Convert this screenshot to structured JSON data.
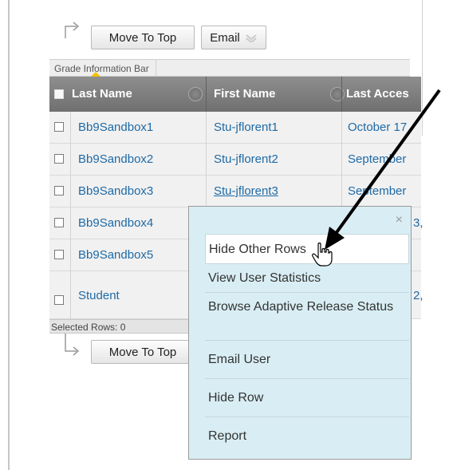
{
  "toolbar_top": {
    "move_to_top": "Move To Top",
    "email": "Email"
  },
  "grade_info_bar": "Grade Information Bar",
  "table": {
    "columns": [
      "Last Name",
      "First Name",
      "Last Acces"
    ],
    "rows": [
      {
        "last": "Bb9Sandbox1",
        "first": "Stu-jflorent1",
        "access": "October 17"
      },
      {
        "last": "Bb9Sandbox2",
        "first": "Stu-jflorent2",
        "access": "September"
      },
      {
        "last": "Bb9Sandbox3",
        "first": "Stu-jflorent3",
        "access": "September"
      },
      {
        "last": "Bb9Sandbox4",
        "first": "",
        "access": "3,"
      },
      {
        "last": "Bb9Sandbox5",
        "first": "",
        "access": ""
      },
      {
        "last": "Student",
        "first": "",
        "access": "2,"
      }
    ]
  },
  "selected_rows": "Selected Rows: 0",
  "toolbar_bottom": {
    "move_to_top": "Move To Top"
  },
  "context_menu": {
    "close": "×",
    "items": [
      "Hide Other Rows",
      "View User Statistics",
      "Browse Adaptive Release Status",
      "Email User",
      "Hide Row",
      "Report"
    ]
  },
  "colors": {
    "link": "#1f6aa5",
    "header": "#7d7d7d",
    "menu_bg": "#d9eef4"
  },
  "icons": [
    "return-arrow-icon",
    "chevron-down-icon",
    "checkbox-icon",
    "sort-options-icon",
    "close-icon",
    "hand-cursor-icon",
    "annotation-arrow-icon"
  ]
}
